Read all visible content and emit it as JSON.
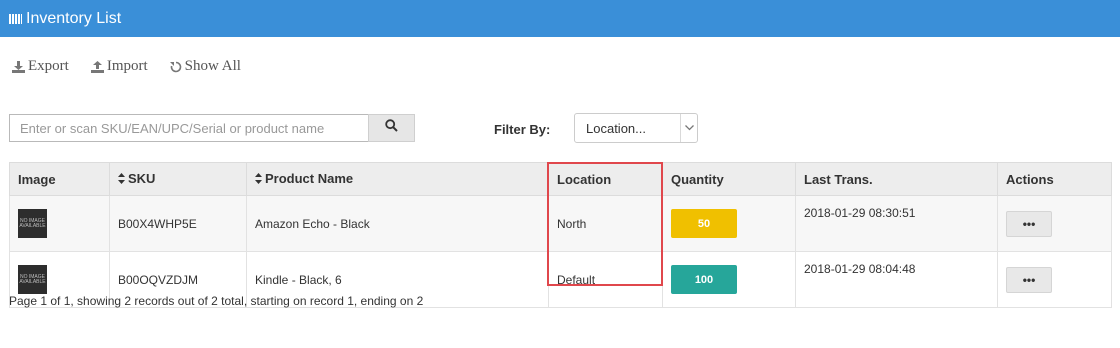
{
  "header": {
    "title": "Inventory List",
    "icon": "list-icon"
  },
  "toolbar": {
    "export_label": "Export",
    "import_label": "Import",
    "show_all_label": "Show All"
  },
  "search": {
    "placeholder": "Enter or scan SKU/EAN/UPC/Serial or product name",
    "value": ""
  },
  "filter": {
    "label": "Filter By:",
    "selected": "Location..."
  },
  "table": {
    "columns": [
      "Image",
      "SKU",
      "Product Name",
      "Location",
      "Quantity",
      "Last Trans.",
      "Actions"
    ],
    "rows": [
      {
        "image_text": "NO IMAGE AVAILABLE",
        "sku": "B00X4WHP5E",
        "name": "Amazon Echo - Black",
        "location": "North",
        "quantity": "50",
        "quantity_color": "#f0c000",
        "last_trans": "2018-01-29 08:30:51",
        "action": "•••"
      },
      {
        "image_text": "NO IMAGE AVAILABLE",
        "sku": "B00OQVZDJM",
        "name": "Kindle - Black, 6",
        "location": "Default",
        "quantity": "100",
        "quantity_color": "#26a69a",
        "last_trans": "2018-01-29 08:04:48",
        "action": "•••"
      }
    ]
  },
  "footer": {
    "text": "Page 1 of 1, showing 2 records out of 2 total, starting on record 1, ending on 2"
  },
  "colors": {
    "header_bg": "#3a8fd8",
    "highlight": "#e0474c"
  }
}
